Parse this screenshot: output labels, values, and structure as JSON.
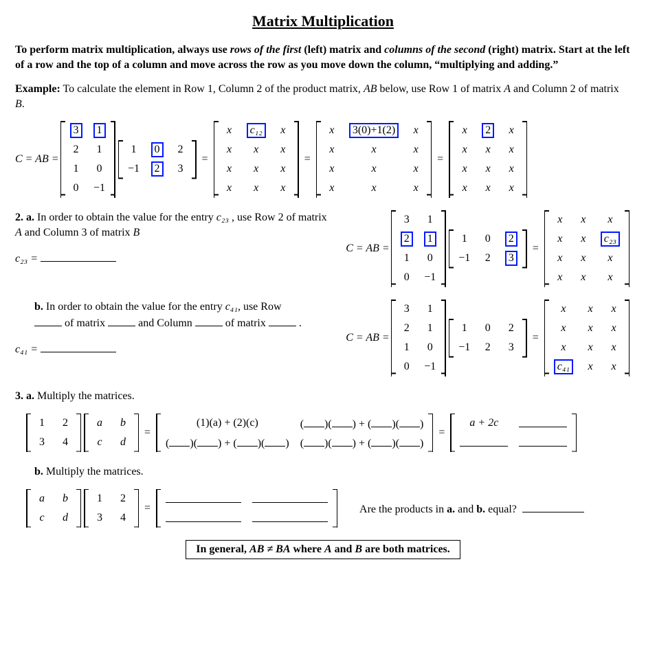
{
  "title": "Matrix Multiplication",
  "intro": {
    "p1a": "To perform matrix multiplication, always use ",
    "p1b": "rows of the first",
    "p1c": " (left) matrix and ",
    "p1d": "columns of the second",
    "p1e": " (right) matrix.  Start at the left of a row and the top of a column and move across the row as you move down the column, “multiplying and adding.”"
  },
  "example": {
    "label": "Example:",
    "text1": " To calculate the element in Row 1, Column 2 of the product matrix, ",
    "ab": "AB",
    "text2": " below, use Row 1 of matrix ",
    "A": "A",
    "text3": " and Column 2 of matrix ",
    "B": "B",
    "period": "."
  },
  "eq1": {
    "lhs": "C = AB =",
    "A": [
      [
        "3",
        "1"
      ],
      [
        "2",
        "1"
      ],
      [
        "1",
        "0"
      ],
      [
        "0",
        "−1"
      ]
    ],
    "B": [
      [
        "1",
        "0",
        "2"
      ],
      [
        "−1",
        "2",
        "3"
      ]
    ],
    "c12": "c₁₂",
    "step": "3(0)+1(2)",
    "final": "2",
    "x": "x"
  },
  "q2a": {
    "prompt1": "2.  a.",
    "text1": " In order to obtain the value for the entry ",
    "c23": "c₂₃",
    "text2": " , use Row 2 of matrix ",
    "A": "A",
    "text3": " and Column 3 of matrix ",
    "B": "B",
    "c23eq": "c₂₃ ="
  },
  "q2a_eq": {
    "lhs": "C = AB =",
    "A": [
      [
        "3",
        "1"
      ],
      [
        "2",
        "1"
      ],
      [
        "1",
        "0"
      ],
      [
        "0",
        "−1"
      ]
    ],
    "B": [
      [
        "1",
        "0",
        "2"
      ],
      [
        "−1",
        "2",
        "3"
      ]
    ],
    "c23": "c₂₃",
    "x": "x"
  },
  "q2b": {
    "prompt": "b.",
    "text1": " In order to obtain the value for the entry ",
    "c41": "c₄₁",
    "text2": ", use Row ",
    "text3": " of matrix ",
    "text4": " and Column ",
    "text5": " of matrix ",
    "period": " .",
    "c41eq": "c₄₁ ="
  },
  "q2b_eq": {
    "lhs": "C = AB =",
    "A": [
      [
        "3",
        "1"
      ],
      [
        "2",
        "1"
      ],
      [
        "1",
        "0"
      ],
      [
        "0",
        "−1"
      ]
    ],
    "B": [
      [
        "1",
        "0",
        "2"
      ],
      [
        "−1",
        "2",
        "3"
      ]
    ],
    "c41": "c₄₁",
    "x": "x"
  },
  "q3a": {
    "prompt": "3.  a.",
    "text": " Multiply the matrices.",
    "M1": [
      [
        "1",
        "2"
      ],
      [
        "3",
        "4"
      ]
    ],
    "M2": [
      [
        "a",
        "b"
      ],
      [
        "c",
        "d"
      ]
    ],
    "step11": "(1)(a) + (2)(c)",
    "res11": "a + 2c"
  },
  "q3b": {
    "prompt": "b.",
    "text": "  Multiply the matrices.",
    "M1": [
      [
        "a",
        "b"
      ],
      [
        "c",
        "d"
      ]
    ],
    "M2": [
      [
        "1",
        "2"
      ],
      [
        "3",
        "4"
      ]
    ],
    "question": "Are the products in ",
    "a": "a.",
    "and": " and ",
    "b": "b.",
    "equal": " equal?"
  },
  "rule": {
    "pre": "In general,  ",
    "ineq": "AB ≠ BA",
    "post": " where ",
    "A": "A",
    "and": " and ",
    "B": "B",
    "tail": " are both matrices."
  }
}
